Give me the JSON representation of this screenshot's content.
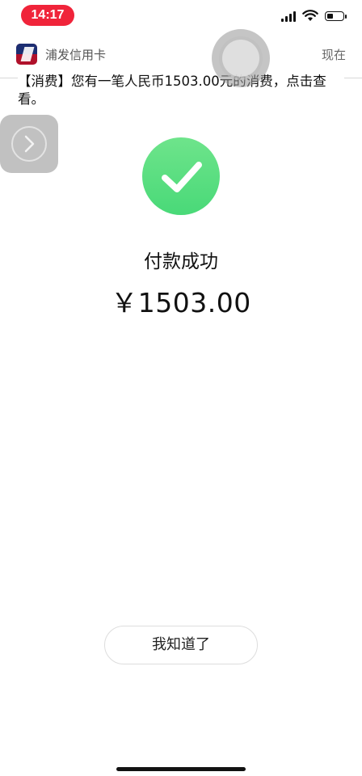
{
  "status_bar": {
    "time": "14:17",
    "time_pill_color": "#f0243a",
    "icons": [
      "signal-icon",
      "wifi-icon",
      "battery-icon"
    ],
    "battery_level": 0.4
  },
  "notification": {
    "app_name": "浦发信用卡",
    "time": "现在",
    "body": "【消费】您有一笔人民币1503.00元的消费，点击查看。",
    "app_icon": "spdb-credit-card-icon"
  },
  "overlays": {
    "assistive_touch_icon": "assistive-touch-icon",
    "side_button_icon": "chevron-right-icon"
  },
  "result": {
    "icon": "checkmark-icon",
    "check_color": "#4cda7a",
    "title": "付款成功",
    "amount": "￥1503.00"
  },
  "actions": {
    "ok_label": "我知道了"
  }
}
